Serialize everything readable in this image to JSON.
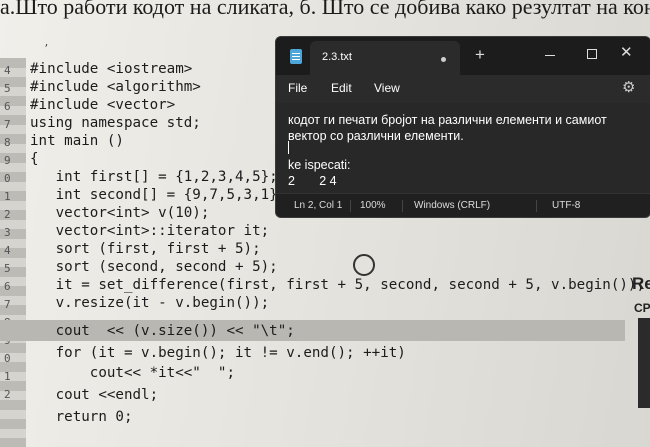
{
  "photo": {
    "heading": "а.Што работи кодот на сликата, б. Што се добива како резултат на конзола",
    "line_numbers": [
      "4",
      "5",
      "6",
      "7",
      "8",
      "9",
      "0",
      "1",
      "2",
      "3",
      "4",
      "5",
      "6",
      "7",
      "8",
      "9",
      "0",
      "1",
      "2"
    ],
    "code_lines": [
      "#include <iostream>",
      "#include <algorithm>",
      "#include <vector>",
      "using namespace std;",
      "int main ()",
      "{",
      "   int first[] = {1,2,3,4,5};",
      "   int second[] = {9,7,5,3,1};",
      "   vector<int> v(10);",
      "   vector<int>::iterator it;",
      "   sort (first, first + 5);",
      "   sort (second, second + 5);",
      "   it = set_difference(first, first + 5, second, second + 5, v.begin());",
      "   v.resize(it - v.begin());",
      "   cout  << (v.size()) << \"\\t\";",
      "   for (it = v.begin(); it != v.end(); ++it)",
      "       cout<< *it<<\"  \";",
      "   cout <<endl;",
      "   return 0;"
    ],
    "side_heading": "Re",
    "side_sub": "CP"
  },
  "notepad": {
    "tab_title": "2.3.txt",
    "new_tab_symbol": "+",
    "minimize_symbol": "—",
    "maximize_symbol": "☐",
    "close_symbol": "✕",
    "menu": [
      "File",
      "Edit",
      "View"
    ],
    "settings_icon": "gear-icon",
    "text_lines": [
      "кодот ги печати бројот на различни елементи и самиот",
      "вектор со различни елементи.",
      "",
      "ke ispecati:",
      "2       2 4"
    ],
    "status": {
      "position": "Ln 2, Col 1",
      "zoom": "100%",
      "line_endings": "Windows (CRLF)",
      "encoding": "UTF-8"
    },
    "accent_color": "#4ea5d9"
  }
}
